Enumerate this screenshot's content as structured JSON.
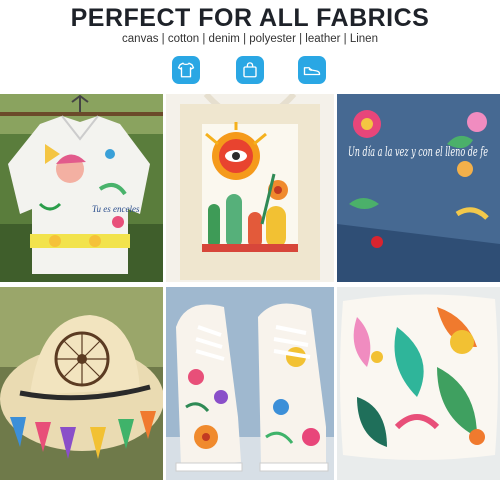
{
  "header": {
    "title": "PERFECT FOR ALL FABRICS",
    "subtitle": "canvas | cotton | denim | polyester | leather | Linen"
  },
  "icons": [
    {
      "name": "tshirt-icon",
      "color": "#2aa7e4"
    },
    {
      "name": "shopping-bag-icon",
      "color": "#2aa7e4"
    },
    {
      "name": "sneaker-icon",
      "color": "#2aa7e4"
    }
  ],
  "tiles": {
    "shirt": {
      "text": "Tu es enceles"
    },
    "jacket": {
      "text": "Un día a la vez y con el lleno de fe"
    }
  }
}
